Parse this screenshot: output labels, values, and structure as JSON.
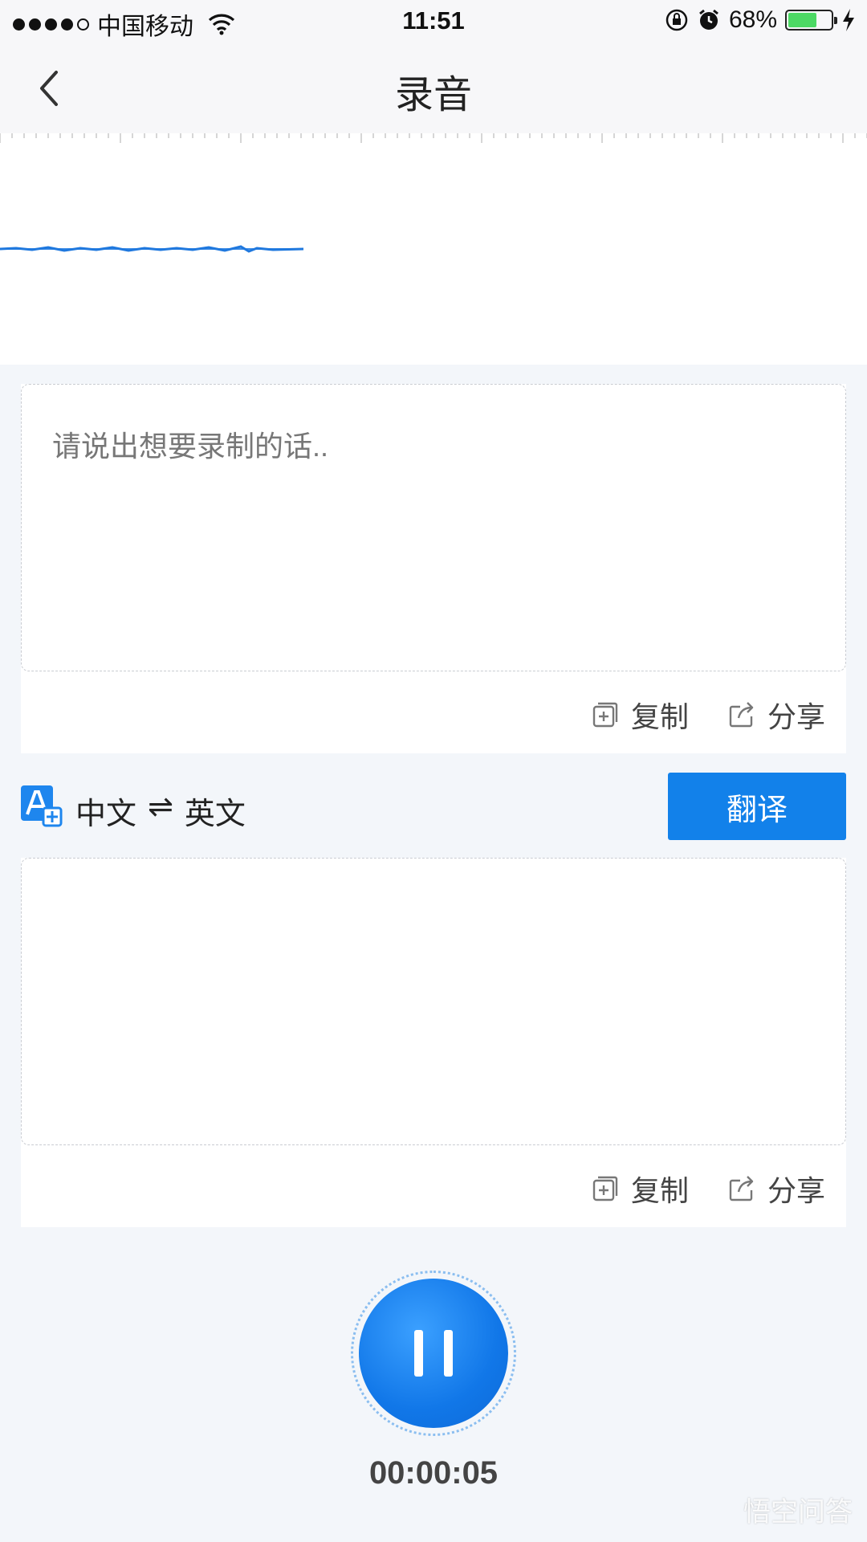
{
  "status_bar": {
    "carrier": "中国移动",
    "time": "11:51",
    "battery": "68%"
  },
  "nav": {
    "title": "录音"
  },
  "transcript": {
    "placeholder": "请说出想要录制的话..",
    "copy_label": "复制",
    "share_label": "分享"
  },
  "translate": {
    "source_lang": "中文",
    "swap_symbol": "⇌",
    "target_lang": "英文",
    "button_label": "翻译",
    "copy_label": "复制",
    "share_label": "分享"
  },
  "recorder": {
    "timer": "00:00:05"
  },
  "watermark": "悟空问答",
  "colors": {
    "accent": "#1281ea",
    "background": "#f3f6fa"
  }
}
